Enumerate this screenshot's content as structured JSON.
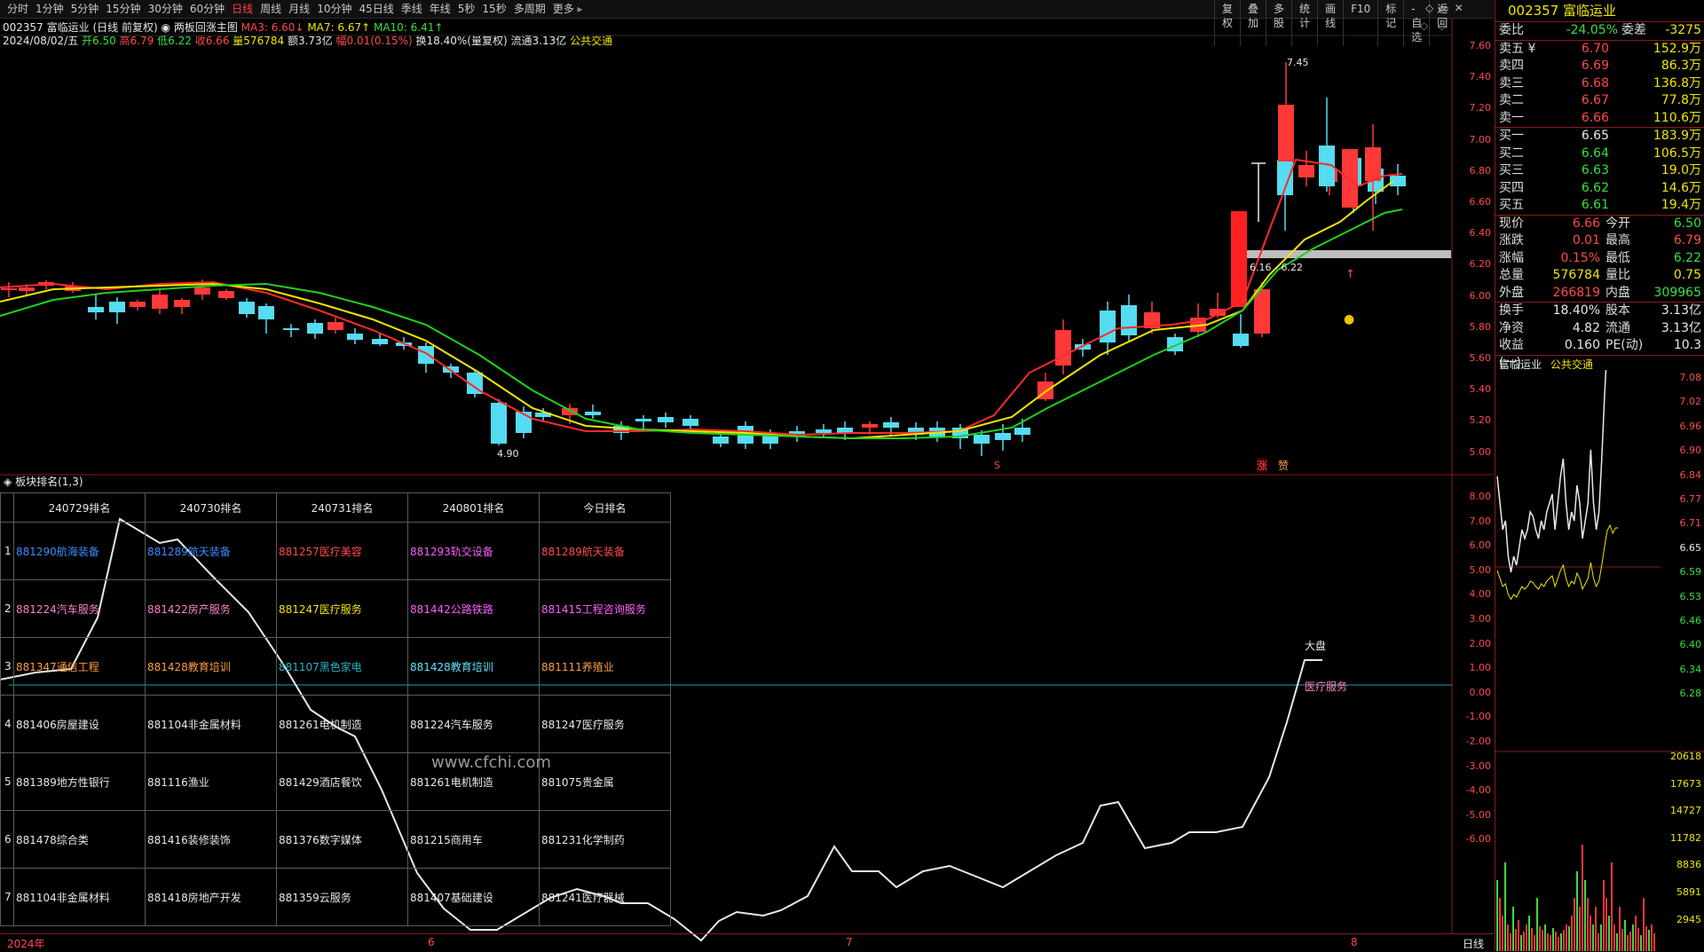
{
  "periods": [
    "分时",
    "1分钟",
    "5分钟",
    "15分钟",
    "30分钟",
    "60分钟",
    "日线",
    "周线",
    "月线",
    "10分钟",
    "45日线",
    "季线",
    "年线",
    "5秒",
    "15秒",
    "多周期",
    "更多"
  ],
  "active_period": "日线",
  "tools": [
    "复权",
    "叠加",
    "多股",
    "统计",
    "画线",
    "F10",
    "标记",
    "-自选",
    "返回"
  ],
  "header1": {
    "code": "002357",
    "name": "富临运业",
    "mode": "(日线 前复权)",
    "sub_icon": "circle-dot",
    "indicator": "两板回涨主图",
    "ma3": "MA3: 6.60↓",
    "ma7": "MA7: 6.67↑",
    "ma10": "MA10: 6.41↑"
  },
  "header2": {
    "date": "2024/08/02/五",
    "open": "开6.50",
    "high": "高6.79",
    "low": "低6.22",
    "close": "收6.66",
    "vol": "量576784",
    "amt": "额3.73亿",
    "chg": "幅0.01(0.15%)",
    "turn": "换18.40%(量复权)",
    "float": "流通3.13亿",
    "sector": "公共交通"
  },
  "price_axis": [
    "7.60",
    "7.40",
    "7.20",
    "7.00",
    "6.80",
    "6.60",
    "6.40",
    "6.20",
    "6.00",
    "5.80",
    "5.60",
    "5.40",
    "5.20",
    "5.00"
  ],
  "candle_labels": {
    "high": "7.45",
    "low": "4.90",
    "level": "6.16 - 6.22"
  },
  "markers": {
    "s": "S",
    "zhang": "涨",
    "second": "赞"
  },
  "panel2_title": "板块排名(1,3)",
  "rank_table": {
    "headers": [
      "240729排名",
      "240730排名",
      "240731排名",
      "240801排名",
      "今日排名"
    ],
    "rows": [
      {
        "n": "1",
        "cells": [
          "881290航海装备",
          "881289航天装备",
          "881257医疗美容",
          "881293轨交设备",
          "881289航天装备"
        ]
      },
      {
        "n": "2",
        "cells": [
          "881224汽车服务",
          "881422房产服务",
          "881247医疗服务",
          "881442公路铁路",
          "881415工程咨询服务"
        ]
      },
      {
        "n": "3",
        "cells": [
          "881347通信工程",
          "881428教育培训",
          "881107黑色家电",
          "881428教育培训",
          "881111养殖业"
        ]
      },
      {
        "n": "4",
        "cells": [
          "881406房屋建设",
          "881104非金属材料",
          "881261电机制造",
          "881224汽车服务",
          "881247医疗服务"
        ]
      },
      {
        "n": "5",
        "cells": [
          "881389地方性银行",
          "881116渔业",
          "881429酒店餐饮",
          "881261电机制造",
          "881075贵金属"
        ]
      },
      {
        "n": "6",
        "cells": [
          "881478综合类",
          "881416装修装饰",
          "881376数字媒体",
          "881215商用车",
          "881231化学制药"
        ]
      },
      {
        "n": "7",
        "cells": [
          "881104非金属材料",
          "881418房地产开发",
          "881359云服务",
          "881407基础建设",
          "881241医疗器械"
        ]
      }
    ]
  },
  "panel2_axis": [
    "8.00",
    "7.00",
    "6.00",
    "5.00",
    "4.00",
    "3.00",
    "2.00",
    "1.00",
    "0.00",
    "-1.00",
    "-2.00",
    "-3.00",
    "-4.00",
    "-5.00",
    "-6.00"
  ],
  "panel2_labels": {
    "dapan": "大盘",
    "overlay": "医疗服务",
    "watermark": "www.cfchi.com"
  },
  "date_axis": {
    "start": "2024年",
    "m6": "6",
    "m7": "7",
    "m8": "8",
    "mode": "日线"
  },
  "quote": {
    "title": "002357  富临运业",
    "weibi": {
      "l": "委比",
      "p": "-24.05%",
      "l2": "委差",
      "v": "-3275"
    },
    "sells": [
      {
        "l": "卖五 ¥",
        "p": "6.70",
        "v": "152.9万"
      },
      {
        "l": "卖四",
        "p": "6.69",
        "v": "86.3万"
      },
      {
        "l": "卖三",
        "p": "6.68",
        "v": "136.8万"
      },
      {
        "l": "卖二",
        "p": "6.67",
        "v": "77.8万"
      },
      {
        "l": "卖一",
        "p": "6.66",
        "v": "110.6万"
      }
    ],
    "buys": [
      {
        "l": "买一",
        "p": "6.65",
        "v": "183.9万"
      },
      {
        "l": "买二",
        "p": "6.64",
        "v": "106.5万"
      },
      {
        "l": "买三",
        "p": "6.63",
        "v": "19.0万"
      },
      {
        "l": "买四",
        "p": "6.62",
        "v": "14.6万"
      },
      {
        "l": "买五",
        "p": "6.61",
        "v": "19.4万"
      }
    ],
    "stats": [
      {
        "l": "现价",
        "a": "6.66",
        "l2": "今开",
        "b": "6.50"
      },
      {
        "l": "涨跌",
        "a": "0.01",
        "l2": "最高",
        "b": "6.79"
      },
      {
        "l": "涨幅",
        "a": "0.15%",
        "l2": "最低",
        "b": "6.22"
      },
      {
        "l": "总量",
        "a": "576784",
        "l2": "量比",
        "b": "0.75"
      },
      {
        "l": "外盘",
        "a": "266819",
        "l2": "内盘",
        "b": "309965"
      }
    ],
    "stats2": [
      {
        "l": "换手",
        "a": "18.40%",
        "l2": "股本",
        "b": "3.13亿"
      },
      {
        "l": "净资",
        "a": "4.82",
        "l2": "流通",
        "b": "3.13亿"
      },
      {
        "l": "收益(一)",
        "a": "0.160",
        "l2": "PE(动)",
        "b": "10.3"
      }
    ],
    "mini_title": "富临运业",
    "mini_sector": "公共交通",
    "mini_price_axis": [
      "7.08",
      "7.02",
      "6.96",
      "6.90",
      "6.84",
      "6.77",
      "6.71",
      "6.65",
      "6.59",
      "6.53",
      "6.46",
      "6.40",
      "6.34",
      "6.28"
    ],
    "mini_vol_axis": [
      "20618",
      "17673",
      "14727",
      "11782",
      "8836",
      "5891",
      "2945"
    ]
  }
}
